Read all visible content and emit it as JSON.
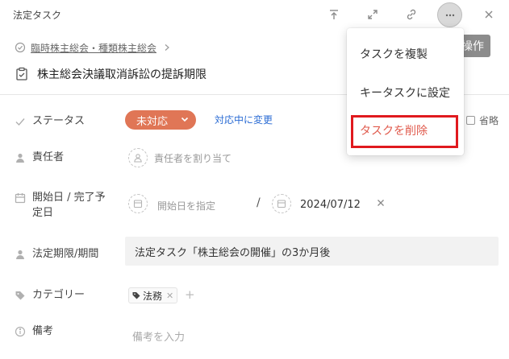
{
  "header": {
    "title": "法定タスク",
    "icons": [
      "tray-upload-icon",
      "expand-icon",
      "link-icon",
      "more-icon",
      "close-icon"
    ]
  },
  "breadcrumb": {
    "parent": "臨時株主総会・種類株主総会"
  },
  "ops_button": {
    "label": "操作"
  },
  "task": {
    "title": "株主総会決議取消訴訟の提訴期限"
  },
  "fields": {
    "status": {
      "label": "ステータス",
      "value": "未対応",
      "change_link": "対応中に変更",
      "omit_label": "省略"
    },
    "assignee": {
      "label": "責任者",
      "placeholder": "責任者を割り当て"
    },
    "dates": {
      "label_line1": "開始日 / 完了予",
      "label_line2": "定日",
      "start_placeholder": "開始日を指定",
      "separator": "/",
      "due_value": "2024/07/12"
    },
    "legal_deadline": {
      "label": "法定期限/期間",
      "value": "法定タスク「株主総会の開催」の3か月後"
    },
    "category": {
      "label": "カテゴリー",
      "tag": "法務"
    },
    "notes": {
      "label": "備考",
      "placeholder": "備考を入力"
    }
  },
  "menu": {
    "items": [
      {
        "label": "タスクを複製"
      },
      {
        "label": "キータスクに設定"
      },
      {
        "label": "タスクを削除"
      }
    ]
  },
  "colors": {
    "status_pill": "#e07656",
    "link": "#2b6cd4",
    "danger": "#e05a4c",
    "highlight": "#e0191e"
  }
}
